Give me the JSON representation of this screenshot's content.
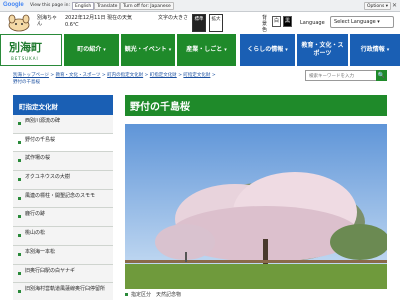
{
  "translate_bar": {
    "brand": "Google",
    "view_text": "View this page in:",
    "lang_value": "English",
    "translate_label": "Translate",
    "off_label": "Turn off for: Japanese",
    "options_label": "Options ▾",
    "close_label": "✕"
  },
  "header": {
    "mini_text": "別海ちゃん",
    "date_line1": "2022年12月11日 現在の天気",
    "date_line2": "0.6℃",
    "font_size_label": "文字の大きさ",
    "font_standard": "標準",
    "font_large": "拡大",
    "bg_label": "背景色",
    "bg_white": "白",
    "bg_black": "黒",
    "bg_blue": "青",
    "language_label": "Language",
    "select_language": "Select Language ▾"
  },
  "nav": {
    "logo": "別海町",
    "logo_sub": "BETSUKAI",
    "items": [
      {
        "label": "町の紹介"
      },
      {
        "label": "観光・イベント"
      },
      {
        "label": "産業・しごと"
      },
      {
        "label": "くらしの情報"
      },
      {
        "label": "教育・文化・スポーツ"
      },
      {
        "label": "行政情報"
      }
    ]
  },
  "breadcrumb": {
    "items": [
      "別海トップページ",
      "教育・文化・スポーツ",
      "町内の指定文化財",
      "町指定文化財",
      "町指定文化財",
      "野付の千島桜"
    ],
    "sep": " > "
  },
  "search": {
    "placeholder": "検索キーワードを入力",
    "button": "🔍"
  },
  "sidebar": {
    "heading": "町指定文化財",
    "items": [
      "西別川源流の碑",
      "野付の千島桜",
      "試作場の桜",
      "オクユネウスの大樹",
      "風連の標柱・開墾記念のスモモ",
      "鹿行の跡",
      "桃山の松",
      "本別海一本松",
      "旧奥行臼駅の白ヤナギ",
      "旧別海村営軌道風蓮線奥行臼停留所"
    ]
  },
  "main": {
    "title": "野付の千島桜",
    "caption": "指定区分　天然記念物"
  },
  "colors": {
    "green": "#1f8a2a",
    "blue": "#1a5fb4"
  }
}
